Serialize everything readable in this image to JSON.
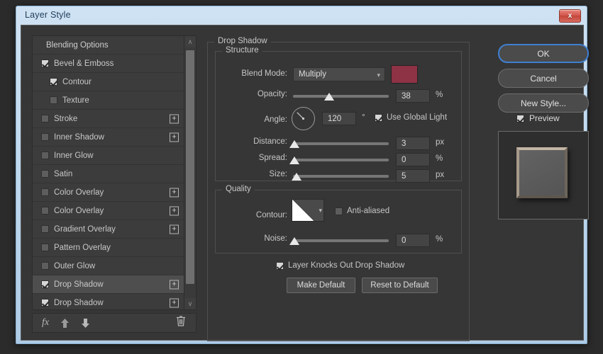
{
  "window": {
    "title": "Layer Style",
    "close_label": "x"
  },
  "sidebar": {
    "items": [
      {
        "label": "Blending Options",
        "checkbox": null,
        "indent": false,
        "plus": false,
        "selected": false
      },
      {
        "label": "Bevel & Emboss",
        "checkbox": true,
        "indent": false,
        "plus": false,
        "selected": false
      },
      {
        "label": "Contour",
        "checkbox": true,
        "indent": true,
        "plus": false,
        "selected": false
      },
      {
        "label": "Texture",
        "checkbox": false,
        "indent": true,
        "plus": false,
        "selected": false
      },
      {
        "label": "Stroke",
        "checkbox": false,
        "indent": false,
        "plus": true,
        "selected": false
      },
      {
        "label": "Inner Shadow",
        "checkbox": false,
        "indent": false,
        "plus": true,
        "selected": false
      },
      {
        "label": "Inner Glow",
        "checkbox": false,
        "indent": false,
        "plus": false,
        "selected": false
      },
      {
        "label": "Satin",
        "checkbox": false,
        "indent": false,
        "plus": false,
        "selected": false
      },
      {
        "label": "Color Overlay",
        "checkbox": false,
        "indent": false,
        "plus": true,
        "selected": false
      },
      {
        "label": "Color Overlay",
        "checkbox": false,
        "indent": false,
        "plus": true,
        "selected": false
      },
      {
        "label": "Gradient Overlay",
        "checkbox": false,
        "indent": false,
        "plus": true,
        "selected": false
      },
      {
        "label": "Pattern Overlay",
        "checkbox": false,
        "indent": false,
        "plus": false,
        "selected": false
      },
      {
        "label": "Outer Glow",
        "checkbox": false,
        "indent": false,
        "plus": false,
        "selected": false
      },
      {
        "label": "Drop Shadow",
        "checkbox": true,
        "indent": false,
        "plus": true,
        "selected": true
      },
      {
        "label": "Drop Shadow",
        "checkbox": true,
        "indent": false,
        "plus": true,
        "selected": false
      }
    ],
    "plus_symbol": "+",
    "toolbar": {
      "fx_label": "fx",
      "move_up_name": "move-up",
      "move_down_name": "move-down",
      "delete_name": "delete"
    },
    "scrollbar": {
      "up": "∧",
      "down": "∨"
    }
  },
  "main": {
    "group_title": "Drop Shadow",
    "structure": {
      "title": "Structure",
      "blend_mode_label": "Blend Mode:",
      "blend_mode_value": "Multiply",
      "color_swatch": "#8e3246",
      "opacity_label": "Opacity:",
      "opacity_value": "38",
      "opacity_unit": "%",
      "angle_label": "Angle:",
      "angle_value": "120",
      "angle_unit": "°",
      "use_global_light_label": "Use Global Light",
      "use_global_light_checked": true,
      "distance_label": "Distance:",
      "distance_value": "3",
      "distance_unit": "px",
      "spread_label": "Spread:",
      "spread_value": "0",
      "spread_unit": "%",
      "size_label": "Size:",
      "size_value": "5",
      "size_unit": "px"
    },
    "quality": {
      "title": "Quality",
      "contour_label": "Contour:",
      "anti_aliased_label": "Anti-aliased",
      "anti_aliased_checked": false,
      "noise_label": "Noise:",
      "noise_value": "0",
      "noise_unit": "%"
    },
    "knockout_label": "Layer Knocks Out Drop Shadow",
    "knockout_checked": true,
    "make_default_label": "Make Default",
    "reset_default_label": "Reset to Default"
  },
  "actions": {
    "ok_label": "OK",
    "cancel_label": "Cancel",
    "new_style_label": "New Style...",
    "preview_label": "Preview",
    "preview_checked": true
  }
}
